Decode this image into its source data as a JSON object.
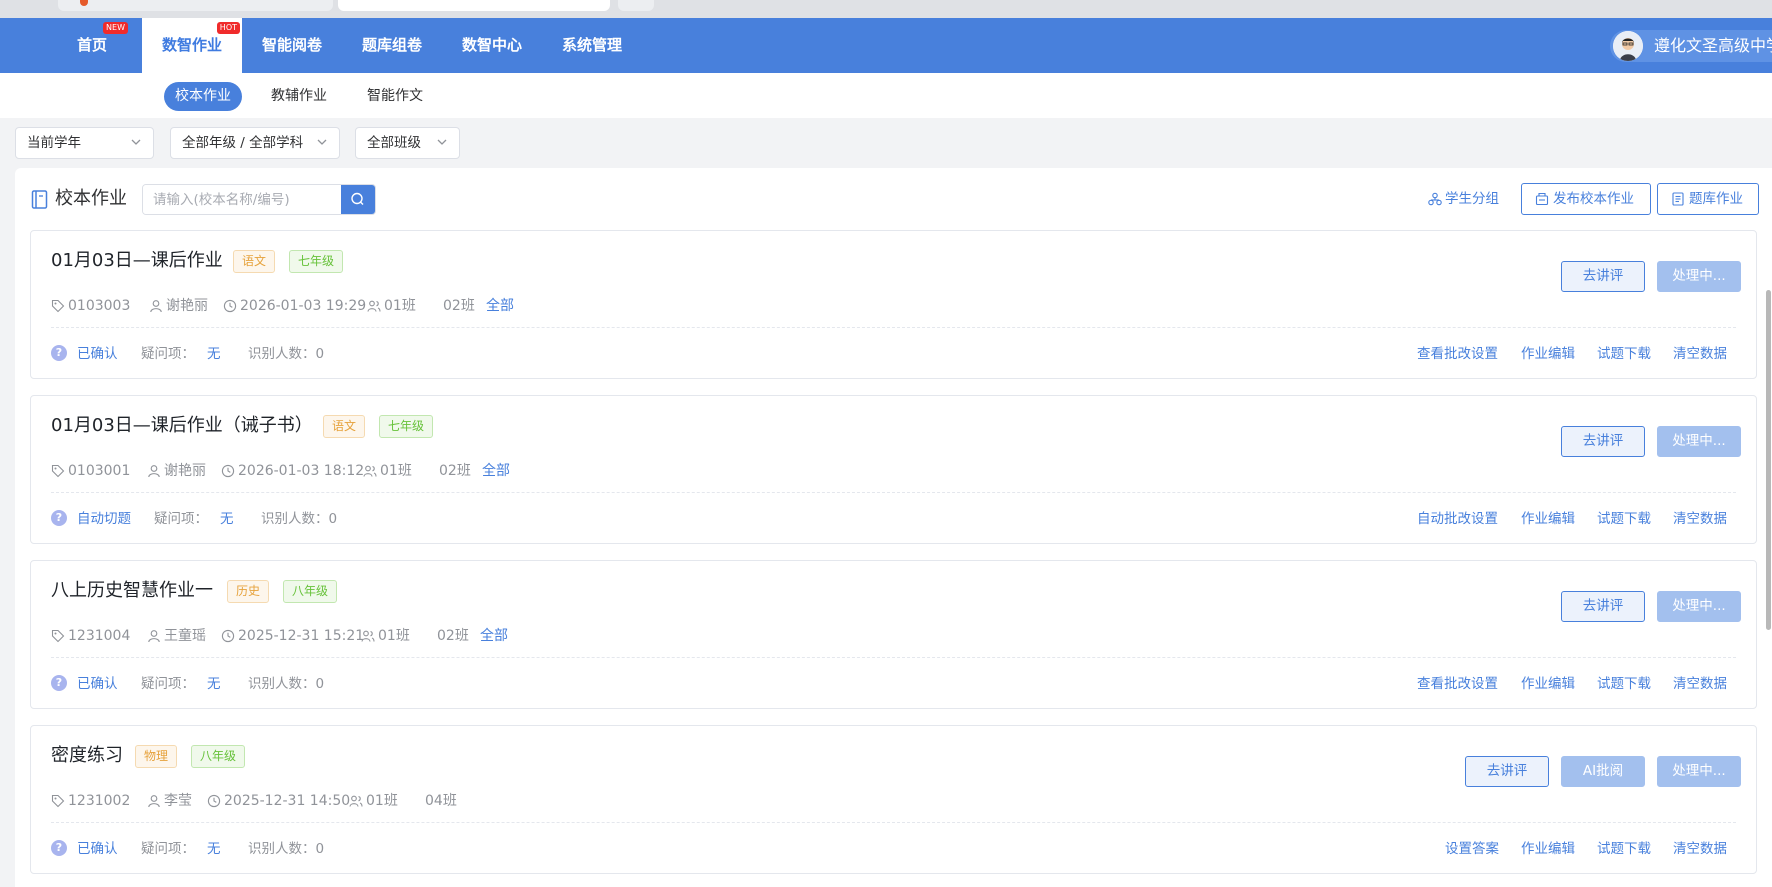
{
  "nav": {
    "items": [
      {
        "label": "首页"
      },
      {
        "label": "数智作业",
        "badge": "NEW",
        "active": true
      },
      {
        "label": "智能阅卷"
      },
      {
        "label": "题库组卷"
      },
      {
        "label": "数智中心"
      },
      {
        "label": "系统管理"
      }
    ],
    "home_badge": "NEW",
    "active_badge": "HOT",
    "user_name": "遵化文圣高级中学"
  },
  "subnav": {
    "items": [
      {
        "label": "校本作业",
        "active": true
      },
      {
        "label": "教辅作业"
      },
      {
        "label": "智能作文"
      }
    ]
  },
  "filters": {
    "year": "当前学年",
    "grade_subject": "全部年级 / 全部学科",
    "class": "全部班级"
  },
  "panel": {
    "title": "校本作业",
    "search_placeholder": "请输入(校本名称/编号)",
    "student_group": "学生分组",
    "publish": "发布校本作业",
    "bank": "题库作业"
  },
  "cards": [
    {
      "title": "01月03日—课后作业",
      "subject": "语文",
      "grade": "七年级",
      "code": "0103003",
      "teacher": "谢艳丽",
      "time": "2026-01-03 19:29",
      "class1": "01班",
      "class2": "02班",
      "all": "全部",
      "status": "已确认",
      "doubt_label": "疑问项：",
      "doubt": "无",
      "recognized": "识别人数：0",
      "review": "去讲评",
      "processing": "处理中...",
      "link1": "查看批改设置",
      "link2": "作业编辑",
      "link3": "试题下载",
      "link4": "清空数据"
    },
    {
      "title": "01月03日—课后作业（诫子书）",
      "subject": "语文",
      "grade": "七年级",
      "code": "0103001",
      "teacher": "谢艳丽",
      "time": "2026-01-03 18:12",
      "class1": "01班",
      "class2": "02班",
      "all": "全部",
      "status": "自动切题",
      "doubt_label": "疑问项：",
      "doubt": "无",
      "recognized": "识别人数：0",
      "review": "去讲评",
      "processing": "处理中...",
      "link1": "自动批改设置",
      "link2": "作业编辑",
      "link3": "试题下载",
      "link4": "清空数据"
    },
    {
      "title": "八上历史智慧作业一",
      "subject": "历史",
      "grade": "八年级",
      "code": "1231004",
      "teacher": "王童瑶",
      "time": "2025-12-31 15:21",
      "class1": "01班",
      "class2": "02班",
      "all": "全部",
      "status": "已确认",
      "doubt_label": "疑问项：",
      "doubt": "无",
      "recognized": "识别人数：0",
      "review": "去讲评",
      "processing": "处理中...",
      "link1": "查看批改设置",
      "link2": "作业编辑",
      "link3": "试题下载",
      "link4": "清空数据"
    },
    {
      "title": "密度练习",
      "subject": "物理",
      "grade": "八年级",
      "code": "1231002",
      "teacher": "李莹",
      "time": "2025-12-31 14:50",
      "class1": "01班",
      "class2": "04班",
      "status": "已确认",
      "doubt_label": "疑问项：",
      "doubt": "无",
      "recognized": "识别人数：0",
      "review": "去讲评",
      "ai": "AI批阅",
      "processing": "处理中...",
      "link1": "设置答案",
      "link2": "作业编辑",
      "link3": "试题下载",
      "link4": "清空数据"
    }
  ],
  "colors": {
    "primary": "#4880dc",
    "tag_orange": "#e6a23c",
    "tag_green": "#67c23a"
  }
}
